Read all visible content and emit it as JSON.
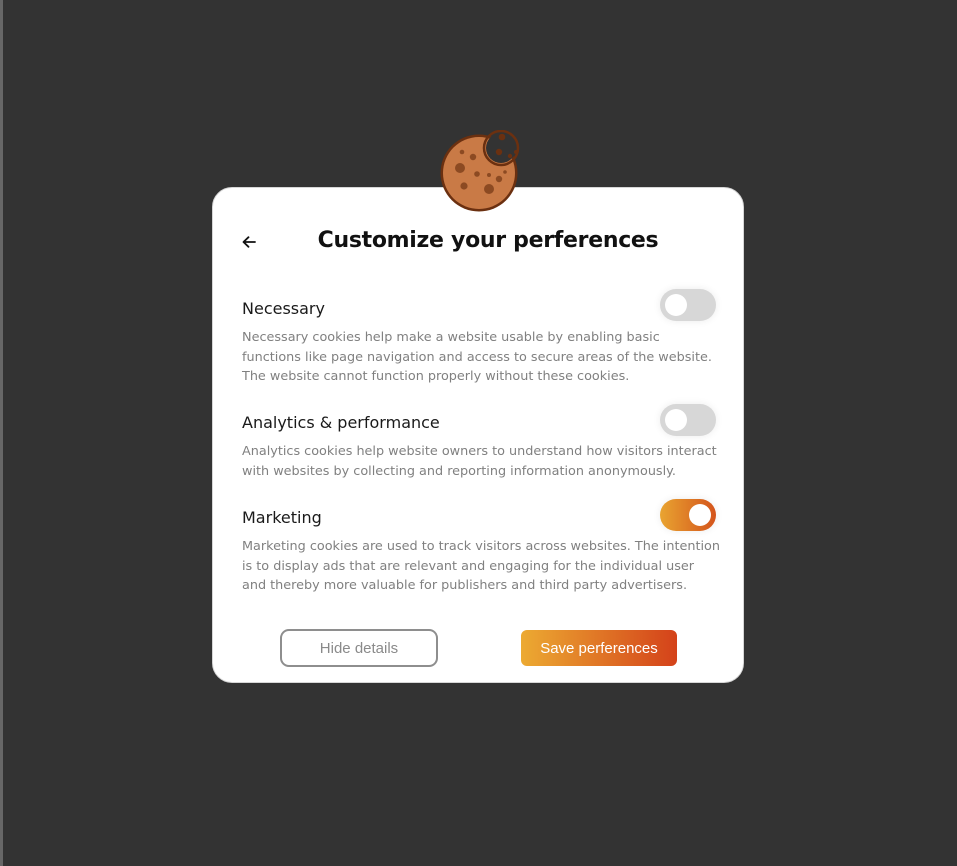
{
  "dialog": {
    "title": "Customize your perferences",
    "back_icon": "arrow-left-icon",
    "cookie_icon": "cookie-icon"
  },
  "sections": [
    {
      "name": "Necessary",
      "description": "Necessary cookies help make a website usable by enabling basic functions like page navigation and access to secure areas of the website. The website cannot function properly without these cookies.",
      "enabled": false
    },
    {
      "name": "Analytics & performance",
      "description": "Analytics cookies help website owners to understand how visitors interact with websites by collecting and reporting information anonymously.",
      "enabled": false
    },
    {
      "name": "Marketing",
      "description": "Marketing cookies are used to track visitors across websites. The intention is to display ads that are relevant and engaging for the individual user and thereby more valuable for publishers and third party advertisers.",
      "enabled": true
    }
  ],
  "buttons": {
    "hide_details": "Hide details",
    "save": "Save perferences"
  },
  "colors": {
    "background": "#333333",
    "accent_start": "#ecaa32",
    "accent_end": "#d4421a",
    "cookie": "#c97a46",
    "cookie_outline": "#6b3010"
  }
}
